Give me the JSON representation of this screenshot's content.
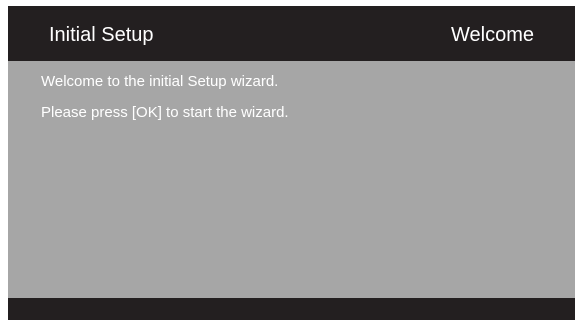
{
  "header": {
    "title": "Initial Setup",
    "step": "Welcome"
  },
  "content": {
    "paragraphs": [
      "Welcome to the initial Setup wizard.",
      "Please press [OK] to start the wizard."
    ]
  },
  "colors": {
    "bar": "#231f20",
    "panel": "#a6a6a6",
    "text": "#ffffff"
  }
}
